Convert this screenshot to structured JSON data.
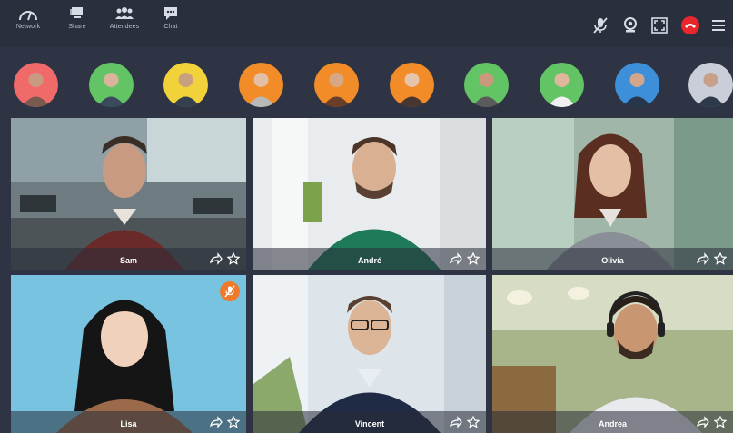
{
  "toolbar": {
    "left": [
      {
        "label": "Network",
        "icon": "network-gauge-icon"
      },
      {
        "label": "Share",
        "icon": "share-screen-icon"
      },
      {
        "label": "Attendees",
        "icon": "attendees-icon"
      },
      {
        "label": "Chat",
        "icon": "chat-icon"
      }
    ],
    "right": [
      "mic-muted-icon",
      "webcam-icon",
      "fullscreen-icon",
      "hang-up-icon",
      "menu-icon"
    ],
    "hangup_color": "#e8262b"
  },
  "participants_strip": {
    "ring_colors": [
      "#f06a6a",
      "#63c465",
      "#f2d23b",
      "#f28c28",
      "#f28c28",
      "#f28c28",
      "#63c465",
      "#63c465",
      "#3d8fd9",
      "#c9ced8"
    ]
  },
  "tiles": [
    {
      "name": "Sam",
      "muted": false
    },
    {
      "name": "André",
      "muted": false
    },
    {
      "name": "Olivia",
      "muted": false
    },
    {
      "name": "Lisa",
      "muted": true
    },
    {
      "name": "Vincent",
      "muted": false
    },
    {
      "name": "Andrea",
      "muted": false
    }
  ],
  "colors": {
    "app_bg": "#2f3444",
    "toolbar_bg": "#2a2f3d",
    "muted_badge": "#f07a2b"
  }
}
